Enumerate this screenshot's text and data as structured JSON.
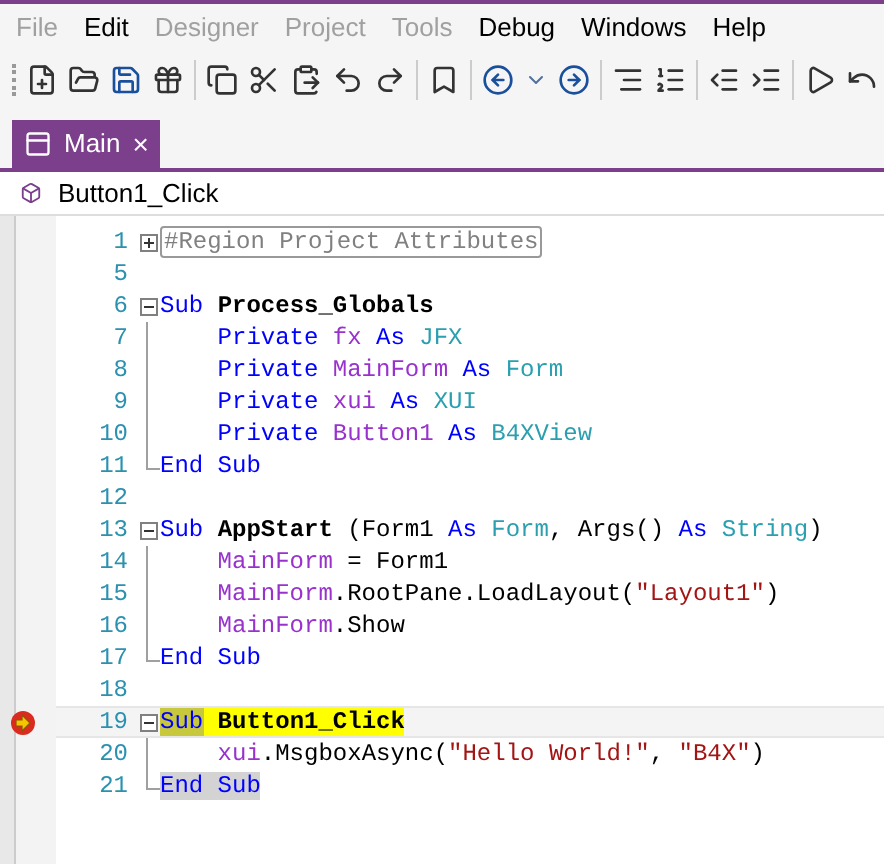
{
  "menu": [
    {
      "label": "File",
      "disabled": true
    },
    {
      "label": "Edit",
      "disabled": false
    },
    {
      "label": "Designer",
      "disabled": true
    },
    {
      "label": "Project",
      "disabled": true
    },
    {
      "label": "Tools",
      "disabled": true
    },
    {
      "label": "Debug",
      "disabled": false
    },
    {
      "label": "Windows",
      "disabled": false
    },
    {
      "label": "Help",
      "disabled": false
    }
  ],
  "tabs": [
    {
      "label": "Main",
      "selected": true,
      "close": "×"
    }
  ],
  "breadcrumb": "Button1_Click",
  "lines": [
    {
      "number": "1",
      "collapsed": true,
      "breakpoint": false,
      "current": false,
      "tokens": [
        {
          "kind": "region",
          "t": "#Region Project Attributes"
        }
      ]
    },
    {
      "number": "5",
      "breakpoint": false,
      "current": false
    },
    {
      "number": "6",
      "collapsed": false,
      "breakpoint": false,
      "current": false,
      "tokens": [
        {
          "kind": "kw",
          "t": "Sub "
        },
        {
          "kind": "bold",
          "t": "Process_Globals"
        }
      ],
      "children": [
        {
          "number": "7",
          "breakpoint": false,
          "current": false,
          "tokens": [
            {
              "kind": "kw",
              "t": "Private "
            },
            {
              "kind": "var",
              "t": "fx "
            },
            {
              "kind": "kw",
              "t": "As "
            },
            {
              "kind": "type",
              "t": "JFX"
            }
          ]
        },
        {
          "number": "8",
          "breakpoint": false,
          "current": false,
          "tokens": [
            {
              "kind": "kw",
              "t": "Private "
            },
            {
              "kind": "var",
              "t": "MainForm "
            },
            {
              "kind": "kw",
              "t": "As "
            },
            {
              "kind": "type",
              "t": "Form"
            }
          ]
        },
        {
          "number": "9",
          "breakpoint": false,
          "current": false,
          "tokens": [
            {
              "kind": "kw",
              "t": "Private "
            },
            {
              "kind": "var",
              "t": "xui "
            },
            {
              "kind": "kw",
              "t": "As "
            },
            {
              "kind": "type",
              "t": "XUI"
            }
          ]
        },
        {
          "number": "10",
          "breakpoint": false,
          "current": false,
          "tokens": [
            {
              "kind": "kw",
              "t": "Private "
            },
            {
              "kind": "var",
              "t": "Button1 "
            },
            {
              "kind": "kw",
              "t": "As "
            },
            {
              "kind": "type",
              "t": "B4XView"
            }
          ]
        },
        {
          "number": "11",
          "end": true,
          "breakpoint": false,
          "current": false,
          "tokens": [
            {
              "kind": "kw",
              "t": "End Sub"
            }
          ]
        }
      ]
    },
    {
      "number": "12",
      "breakpoint": false,
      "current": false
    },
    {
      "number": "13",
      "collapsed": false,
      "breakpoint": false,
      "current": false,
      "tokens": [
        {
          "kind": "kw",
          "t": "Sub "
        },
        {
          "kind": "bold",
          "t": "AppStart"
        },
        {
          "kind": "plain",
          "t": " (Form1 "
        },
        {
          "kind": "kw",
          "t": "As "
        },
        {
          "kind": "type",
          "t": "Form"
        },
        {
          "kind": "plain",
          "t": ", Args() "
        },
        {
          "kind": "kw",
          "t": "As "
        },
        {
          "kind": "type",
          "t": "String"
        },
        {
          "kind": "plain",
          "t": ")"
        }
      ],
      "children": [
        {
          "number": "14",
          "breakpoint": false,
          "current": false,
          "tokens": [
            {
              "kind": "var",
              "t": "MainForm"
            },
            {
              "kind": "plain",
              "t": " = Form1"
            }
          ]
        },
        {
          "number": "15",
          "breakpoint": false,
          "current": false,
          "tokens": [
            {
              "kind": "var",
              "t": "MainForm"
            },
            {
              "kind": "plain",
              "t": ".RootPane.LoadLayout("
            },
            {
              "kind": "str",
              "t": "\"Layout1\""
            },
            {
              "kind": "plain",
              "t": ")"
            }
          ]
        },
        {
          "number": "16",
          "breakpoint": false,
          "current": false,
          "tokens": [
            {
              "kind": "var",
              "t": "MainForm"
            },
            {
              "kind": "plain",
              "t": ".Show"
            }
          ]
        },
        {
          "number": "17",
          "end": true,
          "breakpoint": false,
          "current": false,
          "tokens": [
            {
              "kind": "kw",
              "t": "End Sub"
            }
          ]
        }
      ]
    },
    {
      "number": "18",
      "breakpoint": false,
      "current": false
    },
    {
      "number": "19",
      "collapsed": false,
      "breakpoint": true,
      "current": true,
      "tokens": [
        {
          "kind": "kw",
          "t": "Sub",
          "color": "#c8c83c"
        },
        {
          "kind": "bold",
          "t": " Button1_Click",
          "color": "#ffff00"
        }
      ],
      "children": [
        {
          "number": "20",
          "breakpoint": false,
          "current": false,
          "tokens": [
            {
              "kind": "var",
              "t": "xui"
            },
            {
              "kind": "plain",
              "t": ".MsgboxAsync("
            },
            {
              "kind": "str",
              "t": "\"Hello World!\""
            },
            {
              "kind": "plain",
              "t": ", "
            },
            {
              "kind": "str",
              "t": "\"B4X\""
            },
            {
              "kind": "plain",
              "t": ")"
            }
          ]
        },
        {
          "number": "21",
          "end": true,
          "breakpoint": false,
          "current": false,
          "tokens": [
            {
              "kind": "kw",
              "t": "End Sub",
              "color": "#d3d3d3"
            }
          ]
        }
      ]
    }
  ]
}
